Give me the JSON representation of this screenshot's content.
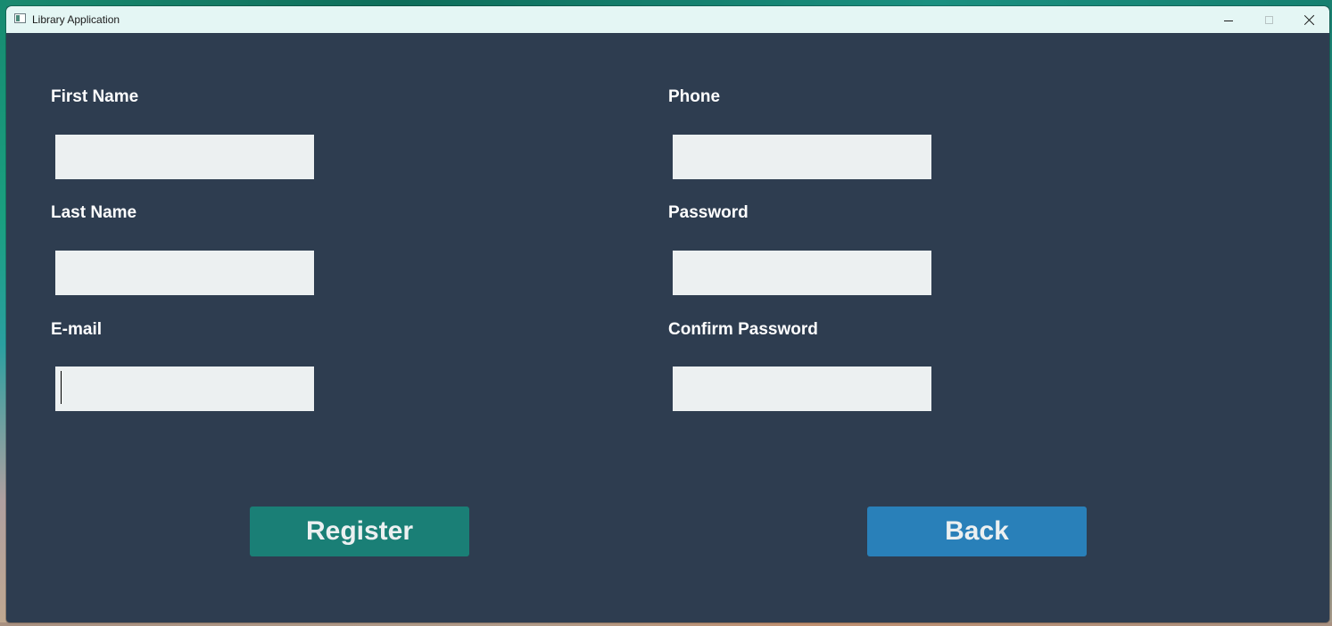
{
  "window": {
    "title": "Library Application"
  },
  "form": {
    "first_name": {
      "label": "First Name",
      "value": ""
    },
    "last_name": {
      "label": "Last Name",
      "value": ""
    },
    "email": {
      "label": "E-mail",
      "value": ""
    },
    "phone": {
      "label": "Phone",
      "value": ""
    },
    "password": {
      "label": "Password",
      "value": ""
    },
    "confirm_password": {
      "label": "Confirm Password",
      "value": ""
    }
  },
  "actions": {
    "register_label": "Register",
    "back_label": "Back"
  },
  "colors": {
    "background": "#2e3d50",
    "input": "#ecf0f1",
    "register": "#1a7f76",
    "back": "#2980b9",
    "label": "#ffffff"
  },
  "icons": {
    "app": "app-window-icon",
    "minimize": "minimize-icon",
    "maximize": "maximize-icon",
    "close": "close-icon"
  }
}
